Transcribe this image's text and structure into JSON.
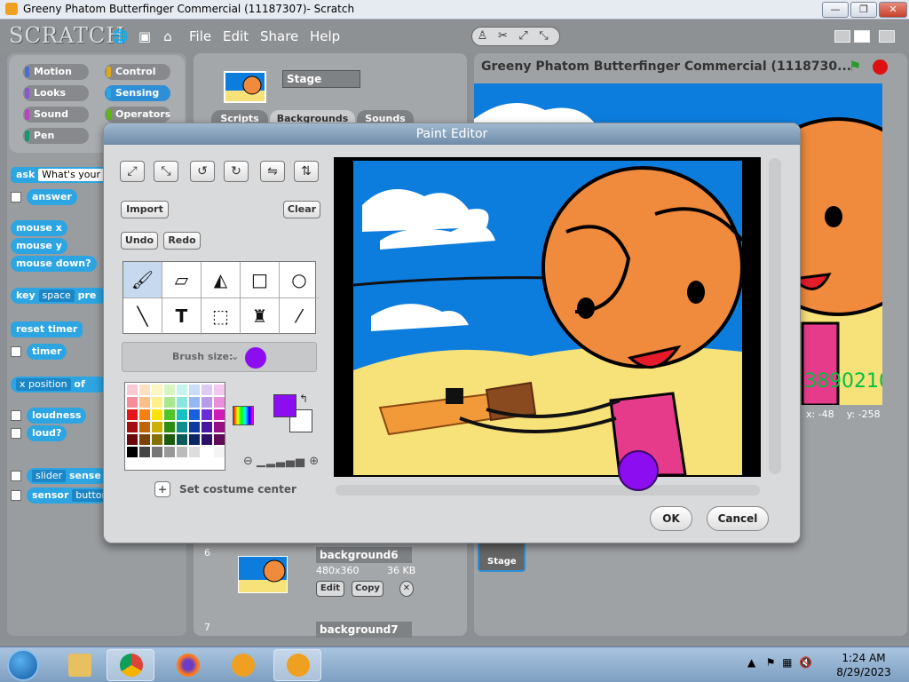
{
  "window": {
    "title": "Greeny Phatom Butterfinger Commercial (11187307)- Scratch",
    "controls": [
      "—",
      "❐",
      "✕"
    ]
  },
  "menubar": {
    "logo": "SCRATCH",
    "menus": [
      "File",
      "Edit",
      "Share",
      "Help"
    ]
  },
  "categories": [
    {
      "label": "Motion",
      "color": "#4a6cd4"
    },
    {
      "label": "Control",
      "color": "#e1a91a"
    },
    {
      "label": "Looks",
      "color": "#8a55d7"
    },
    {
      "label": "Sensing",
      "color": "#2ca5e2"
    },
    {
      "label": "Sound",
      "color": "#bb42c3"
    },
    {
      "label": "Operators",
      "color": "#5cb712"
    },
    {
      "label": "Pen",
      "color": "#0e9a6c"
    }
  ],
  "blocks": {
    "ask": "ask",
    "ask_input": "What's your n",
    "answer": "answer",
    "mouse_x": "mouse x",
    "mouse_y": "mouse y",
    "mouse_down": "mouse down?",
    "key": "key",
    "key_value": "space",
    "key_suffix": "pre",
    "reset_timer": "reset timer",
    "timer": "timer",
    "x_position": "x position",
    "of": "of",
    "loudness": "loudness",
    "loud": "loud?",
    "slider": "slider",
    "sensor_suffix": "sense",
    "sensor": "sensor",
    "sensor_value": "button"
  },
  "center": {
    "stage_name": "Stage",
    "tabs": [
      "Scripts",
      "Backgrounds",
      "Sounds"
    ],
    "costumes": [
      {
        "index": "6",
        "name": "background6",
        "size": "480x360",
        "kb": "36 KB",
        "edit": "Edit",
        "copy": "Copy"
      },
      {
        "index": "7",
        "name": "background7"
      }
    ]
  },
  "stage": {
    "title": "Greeny Phatom Butterfinger Commercial (1118730...",
    "counter": "3890210",
    "mouse_x": "x: -48",
    "mouse_y": "y: -258",
    "sprite_label": "Stage"
  },
  "paint_editor": {
    "title": "Paint Editor",
    "import": "Import",
    "clear": "Clear",
    "undo": "Undo",
    "redo": "Redo",
    "brush_label": "Brush size:",
    "brush_color": "#8b0df0",
    "set_center": "Set costume center",
    "ok": "OK",
    "cancel": "Cancel"
  },
  "taskbar": {
    "time": "1:24 AM",
    "date": "8/29/2023"
  }
}
